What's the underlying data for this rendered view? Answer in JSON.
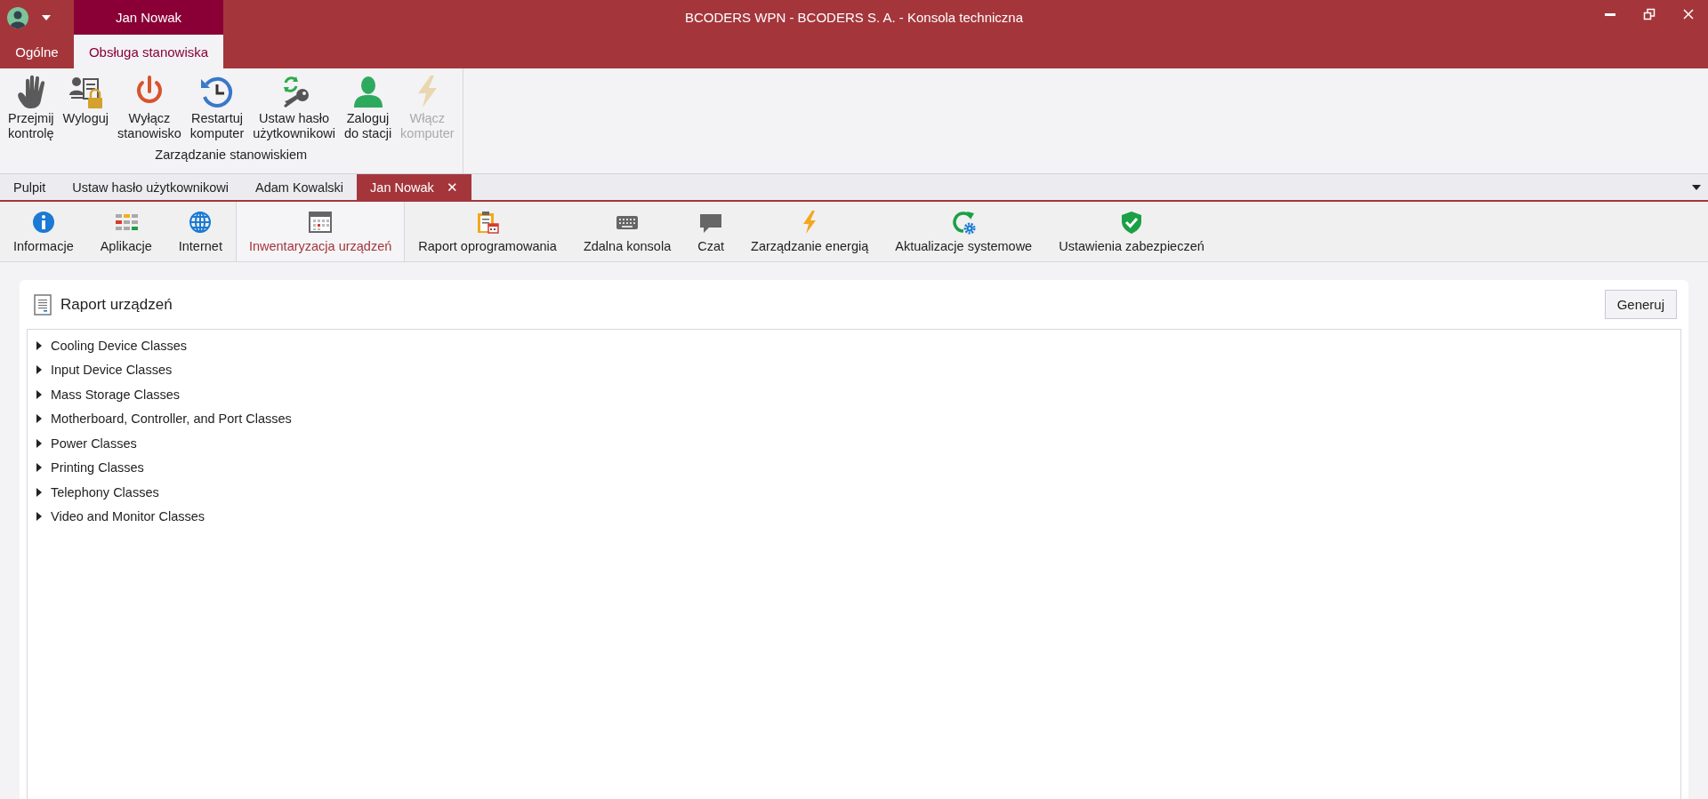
{
  "title_bar": {
    "context_tab": "Jan Nowak",
    "title": "BCODERS WPN - BCODERS S. A. - Konsola techniczna"
  },
  "ribbon_tabs": [
    {
      "label": "Ogólne",
      "selected": false
    },
    {
      "label": "Obsługa stanowiska",
      "selected": true
    }
  ],
  "ribbon_group": {
    "label": "Zarządzanie stanowiskiem",
    "buttons": [
      {
        "label": "Przejmij\nkontrolę",
        "disabled": false
      },
      {
        "label": "Wyloguj",
        "disabled": false
      },
      {
        "label": "Wyłącz\nstanowisko",
        "disabled": false
      },
      {
        "label": "Restartuj\nkomputer",
        "disabled": false
      },
      {
        "label": "Ustaw hasło\nużytkownikowi",
        "disabled": false
      },
      {
        "label": "Zaloguj\ndo stacji",
        "disabled": false
      },
      {
        "label": "Włącz\nkomputer",
        "disabled": true
      }
    ]
  },
  "document_tabs": [
    {
      "label": "Pulpit",
      "selected": false,
      "closable": false
    },
    {
      "label": "Ustaw hasło użytkownikowi",
      "selected": false,
      "closable": false
    },
    {
      "label": "Adam Kowalski",
      "selected": false,
      "closable": false
    },
    {
      "label": "Jan Nowak",
      "selected": true,
      "closable": true
    }
  ],
  "close_glyph": "✕",
  "module_tabs": [
    {
      "label": "Informacje",
      "selected": false
    },
    {
      "label": "Aplikacje",
      "selected": false
    },
    {
      "label": "Internet",
      "selected": false
    },
    {
      "label": "Inwentaryzacja urządzeń",
      "selected": true
    },
    {
      "label": "Raport oprogramowania",
      "selected": false
    },
    {
      "label": "Zdalna konsola",
      "selected": false
    },
    {
      "label": "Czat",
      "selected": false
    },
    {
      "label": "Zarządzanie energią",
      "selected": false
    },
    {
      "label": "Aktualizacje systemowe",
      "selected": false
    },
    {
      "label": "Ustawienia zabezpieczeń",
      "selected": false
    }
  ],
  "panel": {
    "title": "Raport urządzeń",
    "button": "Generuj",
    "tree": [
      {
        "label": "Cooling Device Classes",
        "expanded": false
      },
      {
        "label": "Input Device Classes",
        "expanded": false
      },
      {
        "label": "Mass Storage Classes",
        "expanded": false
      },
      {
        "label": "Motherboard, Controller, and Port Classes",
        "expanded": false
      },
      {
        "label": "Power Classes",
        "expanded": false
      },
      {
        "label": "Printing Classes",
        "expanded": false
      },
      {
        "label": "Telephony Classes",
        "expanded": false
      },
      {
        "label": "Video and Monitor Classes",
        "expanded": false
      }
    ]
  }
}
